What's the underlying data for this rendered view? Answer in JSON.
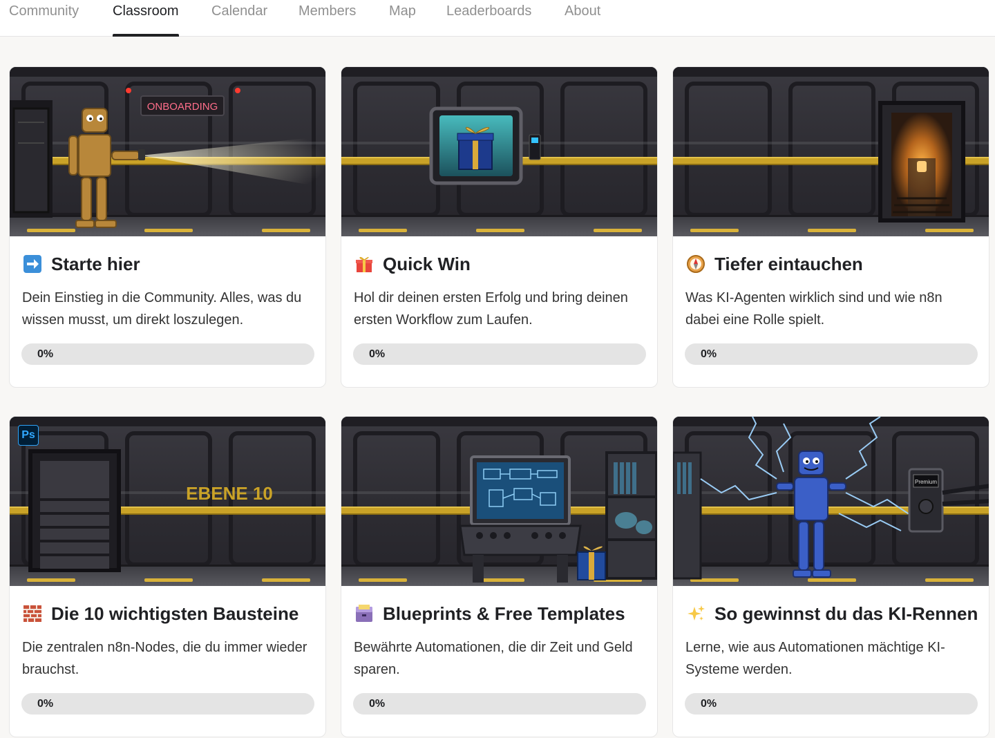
{
  "nav": {
    "tabs": [
      {
        "label": "Community",
        "active": false
      },
      {
        "label": "Classroom",
        "active": true
      },
      {
        "label": "Calendar",
        "active": false
      },
      {
        "label": "Members",
        "active": false
      },
      {
        "label": "Map",
        "active": false
      },
      {
        "label": "Leaderboards",
        "active": false
      },
      {
        "label": "About",
        "active": false
      }
    ]
  },
  "courses": [
    {
      "title": "Starte hier",
      "icon": "right-arrow-emoji-icon",
      "description": "Dein Einstieg in die Community. Alles, was du wissen musst, um direkt loszulegen.",
      "progress_percent": 0,
      "progress_label": "0%",
      "image": {
        "scene": "onboarding-door-robot-with-flashlight",
        "sign_text": "ONBOARDING"
      }
    },
    {
      "title": "Quick Win",
      "icon": "gift-emoji-icon",
      "description": "Hol dir deinen ersten Erfolg und bring deinen ersten Workflow zum Laufen.",
      "progress_percent": 0,
      "progress_label": "0%",
      "image": {
        "scene": "gift-in-wall-display-case"
      }
    },
    {
      "title": "Tiefer eintauchen",
      "icon": "compass-emoji-icon",
      "description": "Was KI-Agenten wirklich sind und wie n8n dabei eine Rolle spielt.",
      "progress_percent": 0,
      "progress_label": "0%",
      "image": {
        "scene": "open-door-stairs-down-with-lamp"
      }
    },
    {
      "title": "Die 10 wichtigsten Bausteine",
      "icon": "bricks-emoji-icon",
      "description": "Die zentralen n8n-Nodes, die du immer wieder brauchst.",
      "progress_percent": 0,
      "progress_label": "0%",
      "image": {
        "scene": "stairwell-level-sign",
        "sign_text": "EBENE 10",
        "badge": "Ps"
      }
    },
    {
      "title": "Blueprints & Free Templates",
      "icon": "card-file-box-emoji-icon",
      "description": "Bewährte Automationen, die dir Zeit und Geld sparen.",
      "progress_percent": 0,
      "progress_label": "0%",
      "image": {
        "scene": "blueprint-console-shelf-gift"
      }
    },
    {
      "title": "So gewinnst du das KI-Rennen",
      "icon": "sparkles-emoji-icon",
      "description": "Lerne, wie aus Automationen mächtige KI-Systeme werden.",
      "progress_percent": 0,
      "progress_label": "0%",
      "image": {
        "scene": "electric-blue-robot-premium-panel",
        "panel_text": "Premium"
      }
    }
  ],
  "colors": {
    "background": "#f8f7f5",
    "card": "#ffffff",
    "progress_track": "#e4e4e4",
    "progress_fill": "#f2c94c",
    "text_primary": "#202124",
    "text_muted": "#909090",
    "hazard_stripe": "#c9a227"
  }
}
